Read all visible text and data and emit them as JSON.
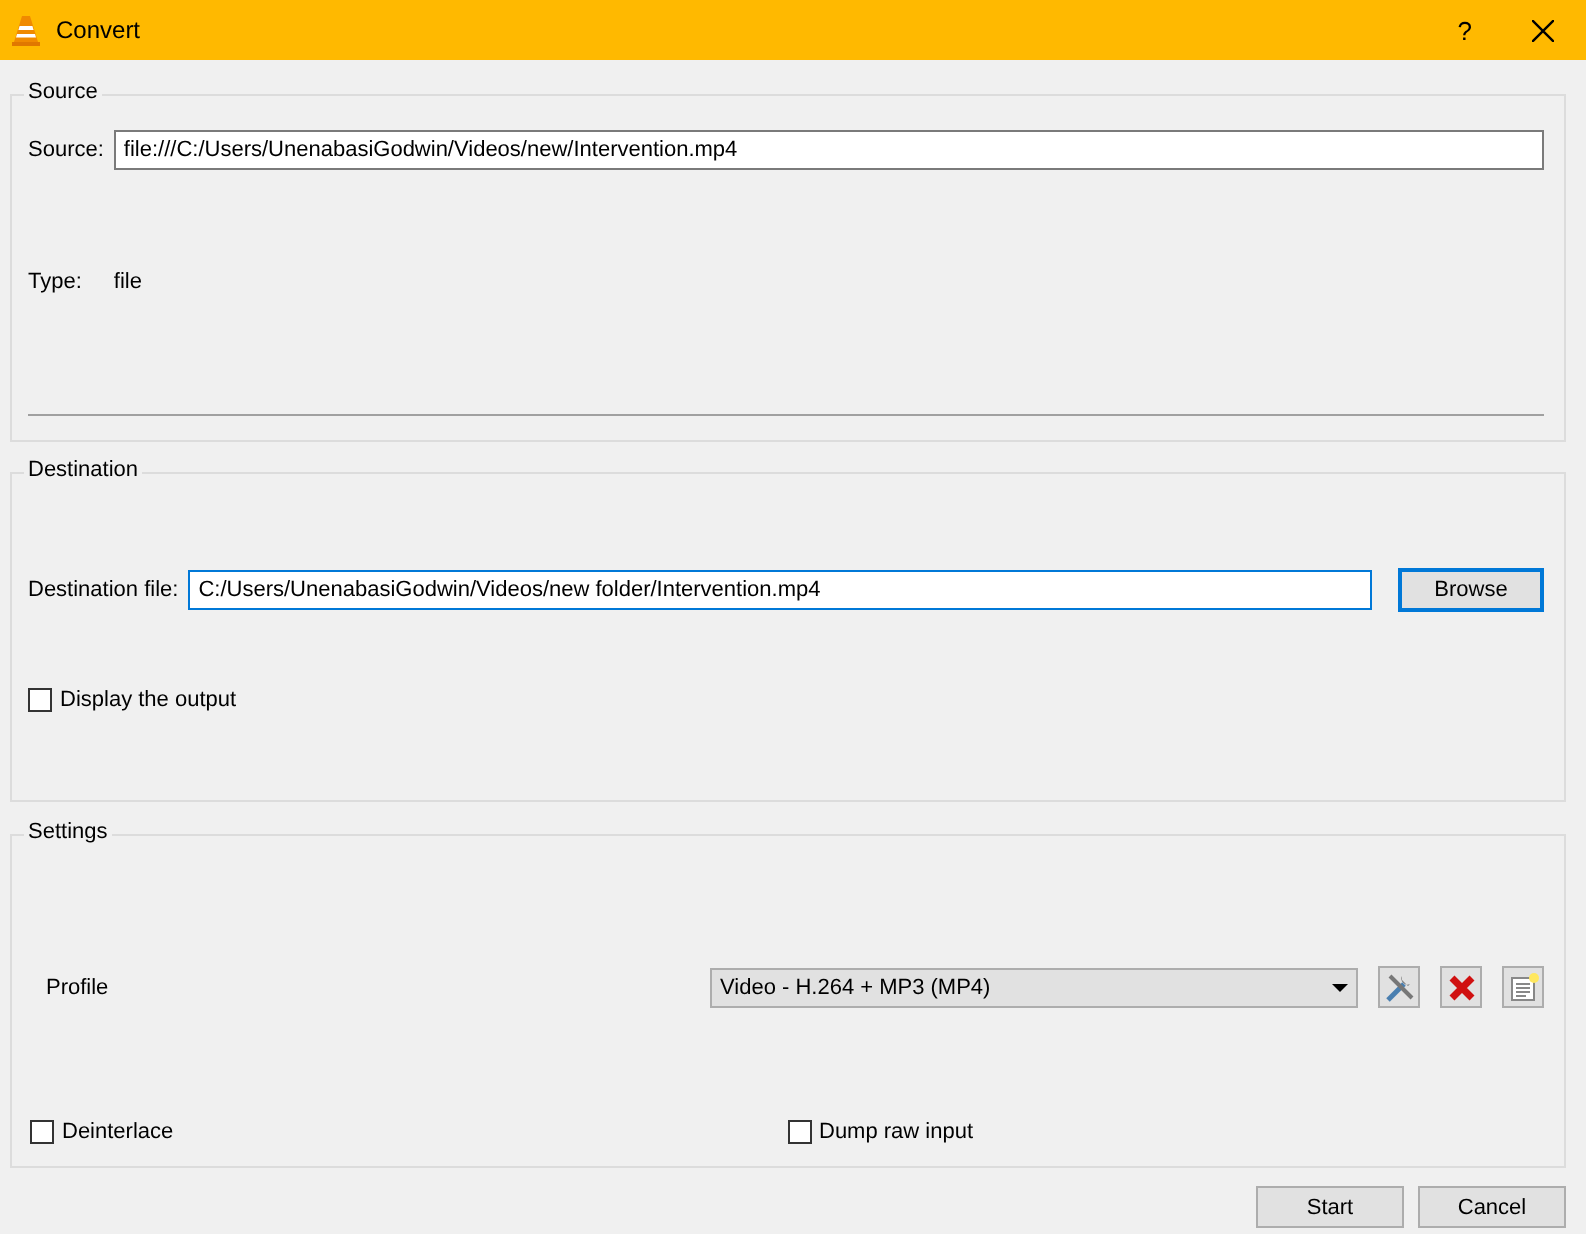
{
  "window": {
    "title": "Convert",
    "help": "?"
  },
  "source": {
    "title": "Source",
    "label": "Source:",
    "value": "file:///C:/Users/UnenabasiGodwin/Videos/new/Intervention.mp4",
    "type_label": "Type:",
    "type_value": "file"
  },
  "destination": {
    "title": "Destination",
    "label": "Destination file:",
    "value": "C:/Users/UnenabasiGodwin/Videos/new folder/Intervention.mp4",
    "browse": "Browse",
    "display_output": {
      "label": "Display the output",
      "checked": false
    }
  },
  "settings": {
    "title": "Settings",
    "profile_label": "Profile",
    "profile": "Video - H.264 + MP3 (MP4)",
    "options": [
      {
        "label": "Deinterlace",
        "checked": false
      },
      {
        "label": "Dump raw input",
        "checked": false
      }
    ]
  },
  "buttons": [
    "Start",
    "Cancel"
  ]
}
